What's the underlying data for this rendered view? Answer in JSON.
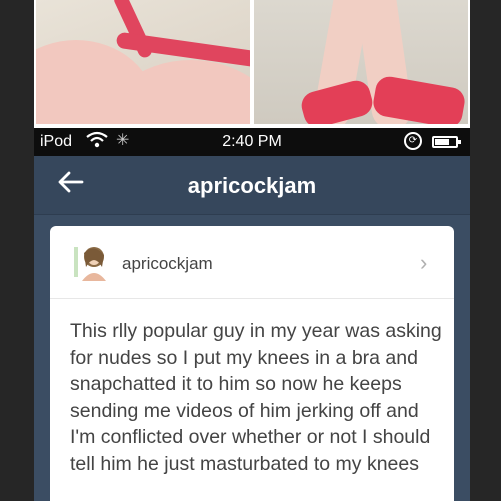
{
  "status_bar": {
    "carrier": "iPod",
    "time": "2:40 PM",
    "battery_level": 0.7
  },
  "nav": {
    "title": "apricockjam",
    "back_icon": "back-arrow-icon"
  },
  "post": {
    "username": "apricockjam",
    "text": "This rlly popular guy in my year was asking for nudes so I put my knees in a bra and snapchatted it to him so now he keeps sending me videos of him jerking off and I'm conflicted over whether or not I should tell him he just masturbated to my knees"
  },
  "colors": {
    "nav_bg": "#36475c",
    "screen_bg": "#3b4d63",
    "accent_pink": "#e33f57"
  }
}
